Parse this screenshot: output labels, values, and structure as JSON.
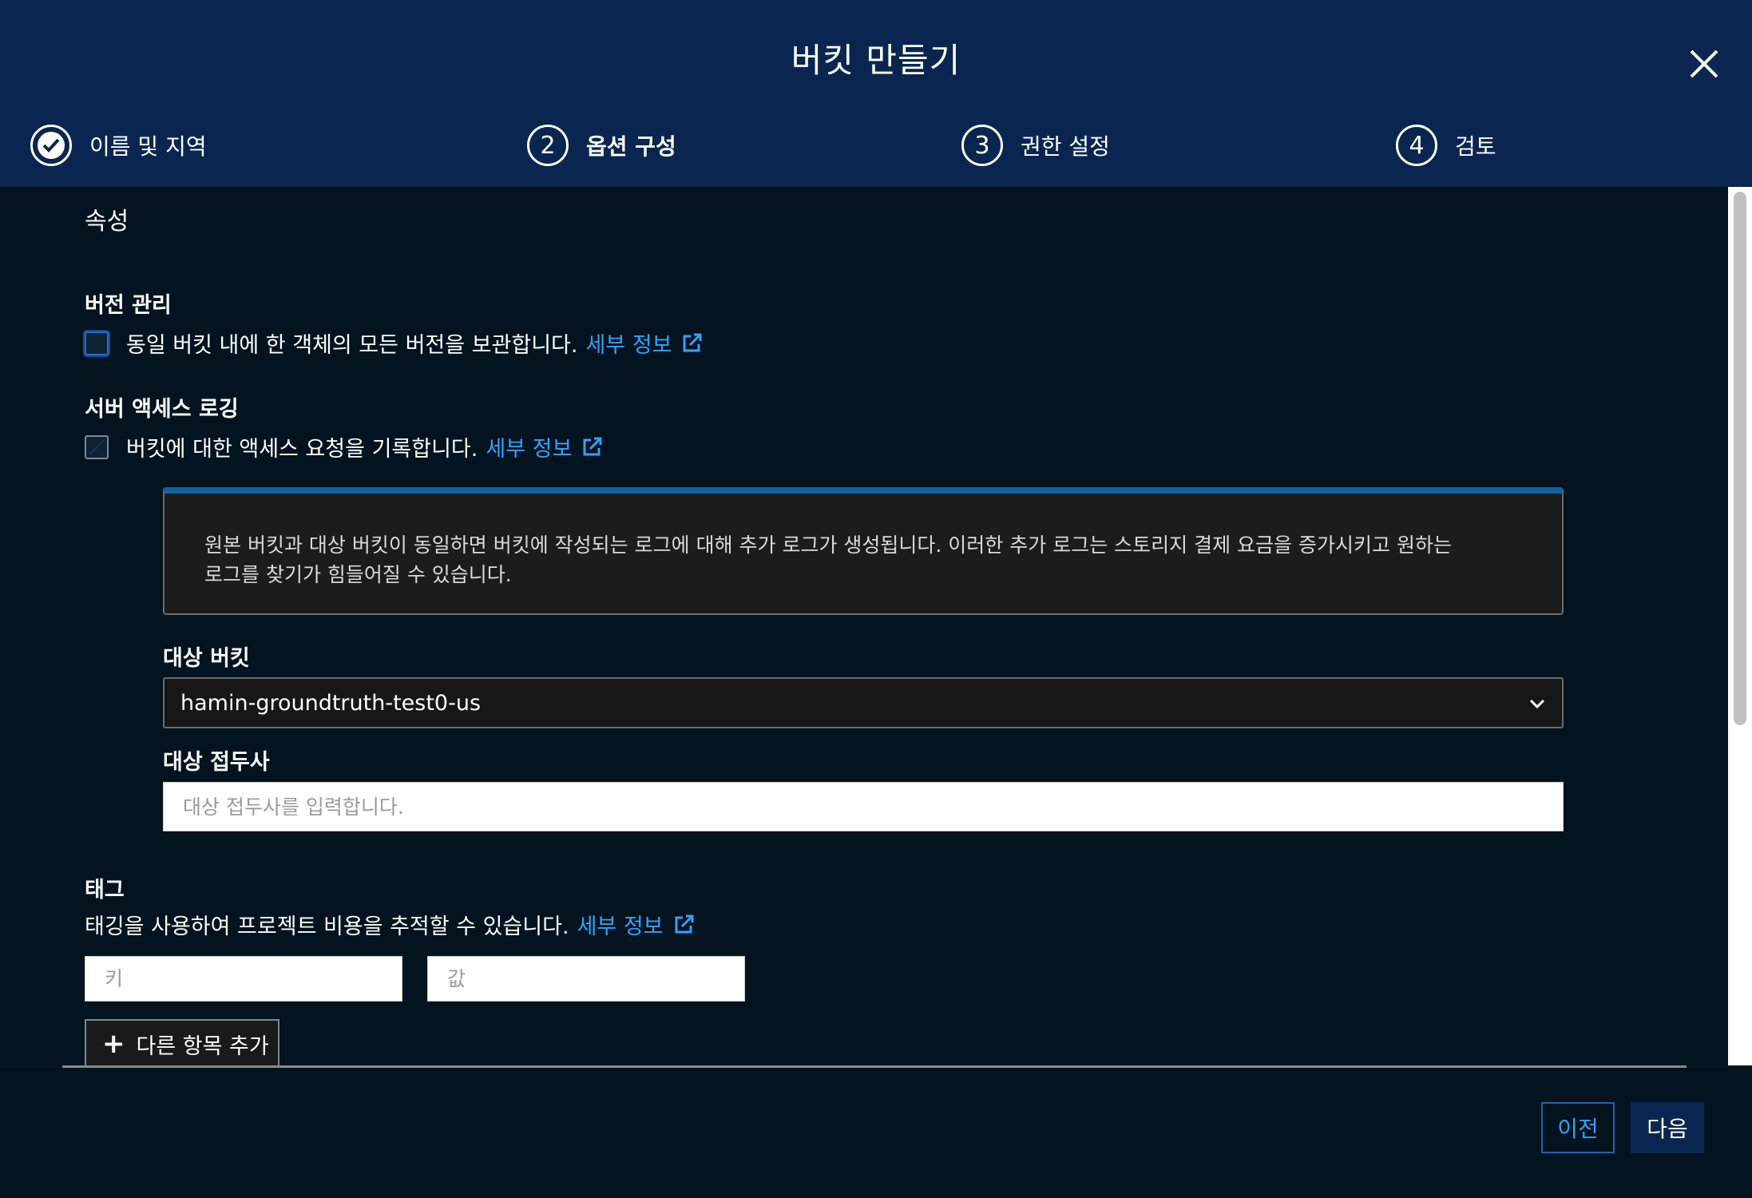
{
  "modal": {
    "title": "버킷 만들기",
    "close_icon": "close-icon"
  },
  "steps": [
    {
      "label": "이름 및 지역",
      "marker": "✓",
      "state": "completed"
    },
    {
      "label": "옵션 구성",
      "marker": "2",
      "state": "active"
    },
    {
      "label": "권한 설정",
      "marker": "3",
      "state": "pending"
    },
    {
      "label": "검토",
      "marker": "4",
      "state": "pending"
    }
  ],
  "section_title": "속성",
  "versioning": {
    "heading": "버전 관리",
    "checkbox_label": "동일 버킷 내에 한 객체의 모든 버전을 보관합니다.",
    "checked": false,
    "link": "세부 정보"
  },
  "logging": {
    "heading": "서버 액세스 로깅",
    "checkbox_label": "버킷에 대한 액세스 요청을 기록합니다.",
    "checked": true,
    "link": "세부 정보",
    "info_line1": "원본 버킷과 대상 버킷이 동일하면 버킷에 작성되는 로그에 대해 추가 로그가 생성됩니다. 이러한 추가 로그는 스토리지 결제 요금을 증가시키고 원하는",
    "info_line2": "로그를 찾기가 힘들어질 수 있습니다.",
    "target_bucket_label": "대상 버킷",
    "target_bucket_value": "hamin-groundtruth-test0-us",
    "target_prefix_label": "대상 접두사",
    "target_prefix_placeholder": "대상 접두사를 입력합니다."
  },
  "tags": {
    "heading": "태그",
    "description": "태깅을 사용하여 프로젝트 비용을 추적할 수 있습니다.",
    "link": "세부 정보",
    "key_placeholder": "키",
    "value_placeholder": "값",
    "add_button": "다른 항목 추가"
  },
  "footer": {
    "prev_label": "이전",
    "next_label": "다음"
  },
  "colors": {
    "header_bg": "#0a2650",
    "content_bg": "#03131f",
    "link": "#2ea4ff",
    "info_border": "#0c63a4"
  }
}
